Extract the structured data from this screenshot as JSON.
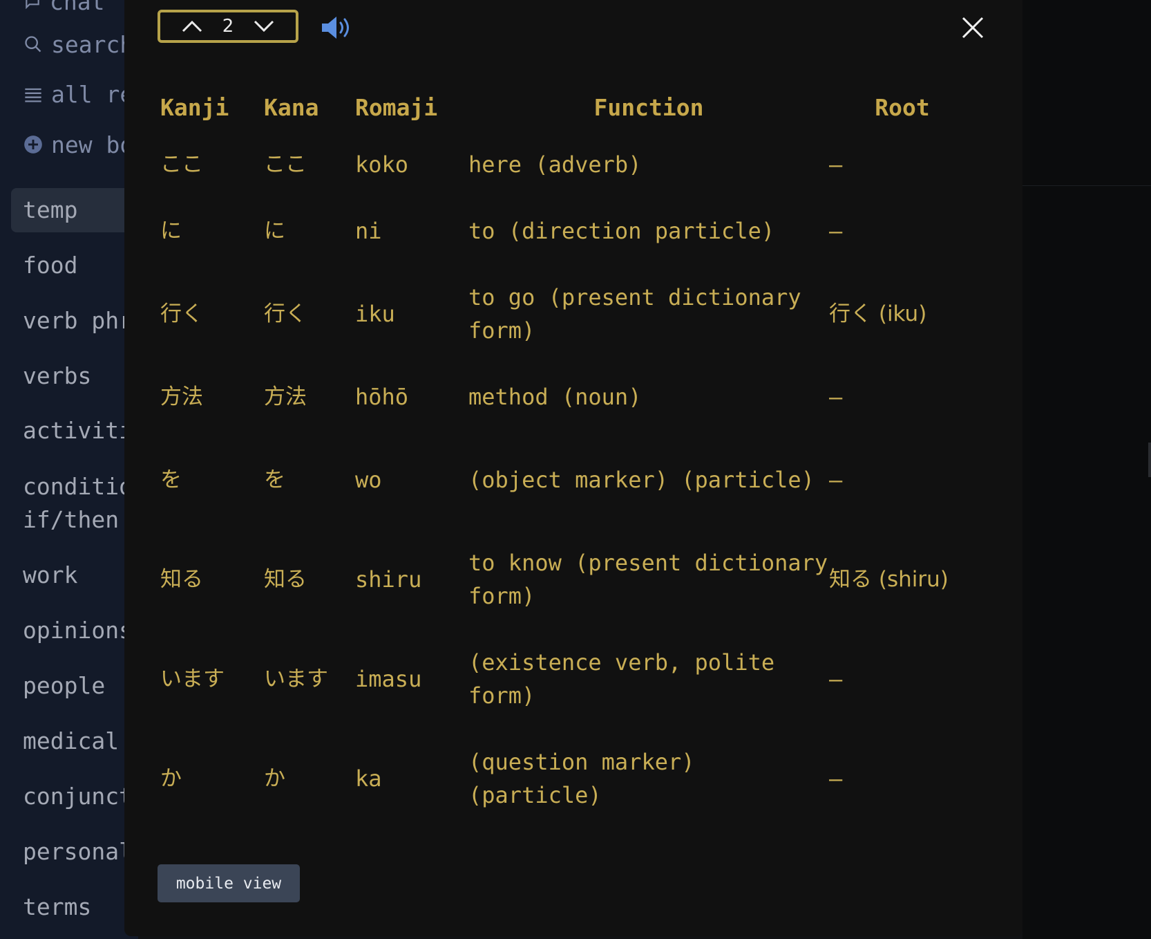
{
  "sidebar": {
    "top_items": [
      {
        "label": "chat",
        "icon": "chat-icon"
      },
      {
        "label": "search",
        "icon": "search-icon"
      },
      {
        "label": "all recent",
        "icon": "list-icon"
      },
      {
        "label": "new board",
        "icon": "plus-circle-icon"
      }
    ],
    "items": [
      {
        "label": "temp"
      },
      {
        "label": "food"
      },
      {
        "label": "verb phrases"
      },
      {
        "label": "verbs"
      },
      {
        "label": "activities"
      },
      {
        "label": "conditional",
        "label2": "if/then"
      },
      {
        "label": "work"
      },
      {
        "label": "opinions"
      },
      {
        "label": "people"
      },
      {
        "label": "medical"
      },
      {
        "label": "conjunctions"
      },
      {
        "label": "personal"
      },
      {
        "label": "terms"
      }
    ]
  },
  "modal": {
    "pager_value": "2",
    "icons": {
      "prev": "chevron-up-icon",
      "next": "chevron-down-icon",
      "speaker": "speaker-icon",
      "close": "close-icon"
    },
    "colors": {
      "accent": "#c9ae55",
      "pager_border": "#b7a34a",
      "speaker": "#5b8fe0",
      "button_bg": "#3b4556"
    },
    "table": {
      "headers": [
        "Kanji",
        "Kana",
        "Romaji",
        "Function",
        "Root"
      ],
      "rows": [
        {
          "kanji": "ここ",
          "kana": "ここ",
          "romaji": "koko",
          "function": "here (adverb)",
          "root": "–"
        },
        {
          "kanji": "に",
          "kana": "に",
          "romaji": "ni",
          "function": "to (direction particle)",
          "root": "–"
        },
        {
          "kanji": "行く",
          "kana": "行く",
          "romaji": "iku",
          "function": "to go (present dictionary form)",
          "root": "行く (iku)"
        },
        {
          "kanji": "方法",
          "kana": "方法",
          "romaji": "hōhō",
          "function": "method (noun)",
          "root": "–"
        },
        {
          "kanji": "を",
          "kana": "を",
          "romaji": "wo",
          "function": "(object marker) (particle)",
          "root": "–"
        },
        {
          "kanji": "知る",
          "kana": "知る",
          "romaji": "shiru",
          "function": "to know (present dictionary form)",
          "root": "知る (shiru)"
        },
        {
          "kanji": "います",
          "kana": "います",
          "romaji": "imasu",
          "function": "(existence verb, polite form)",
          "root": "–"
        },
        {
          "kanji": "か",
          "kana": "か",
          "romaji": "ka",
          "function": "(question marker) (particle)",
          "root": "–"
        }
      ]
    },
    "mobile_button_label": "mobile view"
  }
}
